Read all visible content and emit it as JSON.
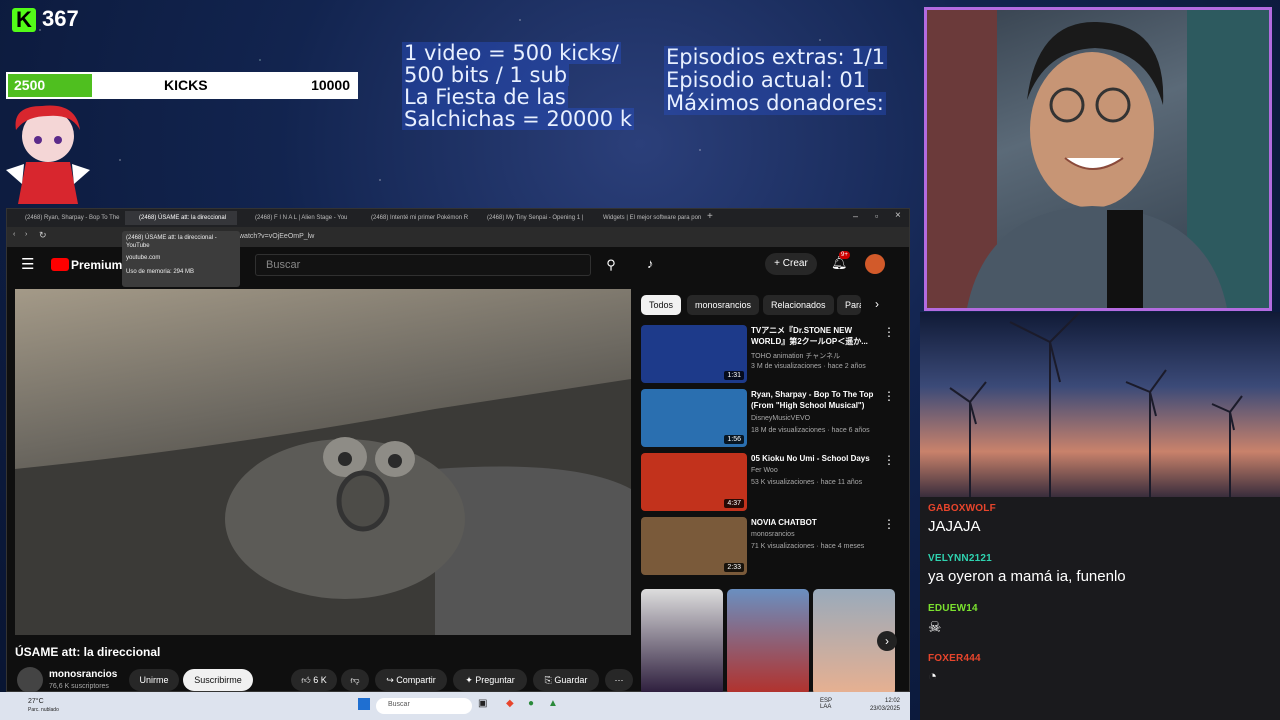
{
  "overlay": {
    "kick_count": "367",
    "kick_logo": "K",
    "goal_bar": {
      "min": "2500",
      "label": "KICKS",
      "max": "10000",
      "progress": 0.24
    },
    "promo_lines": [
      "1 video = 500 kicks/",
      "500 bits / 1 sub",
      "La Fiesta de las",
      "Salchichas = 20000 k"
    ],
    "info_lines": [
      "Episodios extras: 1/1",
      "Episodio actual: 01",
      "Máximos donadores:"
    ]
  },
  "chat": [
    {
      "user": "GABOXWOLF",
      "color": "#e8452c",
      "text": "JAJAJA"
    },
    {
      "user": "VELYNN2121",
      "color": "#2fd3b0",
      "text": "ya oyeron a mamá ia, funenlo"
    },
    {
      "user": "EDUEW14",
      "color": "#7be12f",
      "text": ""
    },
    {
      "user": "FOXER444",
      "color": "#e8452c",
      "text": ""
    }
  ],
  "browser": {
    "tabs": [
      "(2468) Ryan, Sharpay - Bop To The Ti",
      "(2468) ÚSAME att: la direccional",
      "(2468) F I N A L | Alien Stage - You",
      "(2468) Intenté mi primer Pokémon R",
      "(2468) My Tiny Senpai - Opening 1 |",
      "Widgets | El mejor software para pon"
    ],
    "url": "watch?v=vOjEeOmP_lw",
    "tooltip": {
      "title": "(2468) ÚSAME att: la direccional -",
      "site": "YouTube",
      "domain": "youtube.com",
      "memory": "Uso de memoria: 294 MB"
    }
  },
  "youtube": {
    "logo": "Premium",
    "search_placeholder": "Buscar",
    "create_label": "Crear",
    "notif_count": "9+",
    "video_title": "ÚSAME att: la direccional",
    "channel": "monosrancios",
    "subscribers": "76,6 K suscriptores",
    "join": "Unirme",
    "subscribe": "Suscribirme",
    "likes": "6 K",
    "share": "Compartir",
    "ask": "Preguntar",
    "save": "Guardar",
    "chips": [
      "Todos",
      "monosrancios",
      "Relacionados",
      "Para"
    ],
    "recommendations": [
      {
        "title": "TVアニメ『Dr.STONE NEW WORLD』第2クールOP＜遥か...",
        "channel": "TOHO animation チャンネル",
        "meta": "3 M de visualizaciones · hace 2 años",
        "duration": "1:31",
        "color": "#1d3a8a"
      },
      {
        "title": "Ryan, Sharpay - Bop To The Top (From \"High School Musical\")",
        "channel": "DisneyMusicVEVO",
        "meta": "18 M de visualizaciones · hace 6 años",
        "duration": "1:56",
        "color": "#2a6fb0"
      },
      {
        "title": "05 Kioku No Umi - School Days",
        "channel": "Fer Woo",
        "meta": "53 K visualizaciones · hace 11 años",
        "duration": "4:37",
        "color": "#c2321c"
      },
      {
        "title": "NOVIA CHATBOT",
        "channel": "monosrancios",
        "meta": "71 K visualizaciones · hace 4 meses",
        "duration": "2:33",
        "color": "#7a5a3a"
      }
    ]
  },
  "taskbar": {
    "weather": "27°C",
    "weather_desc": "Parc. nublado",
    "search": "Buscar",
    "lang": "ESP LAA",
    "time": "12:02",
    "date": "23/03/2025"
  }
}
